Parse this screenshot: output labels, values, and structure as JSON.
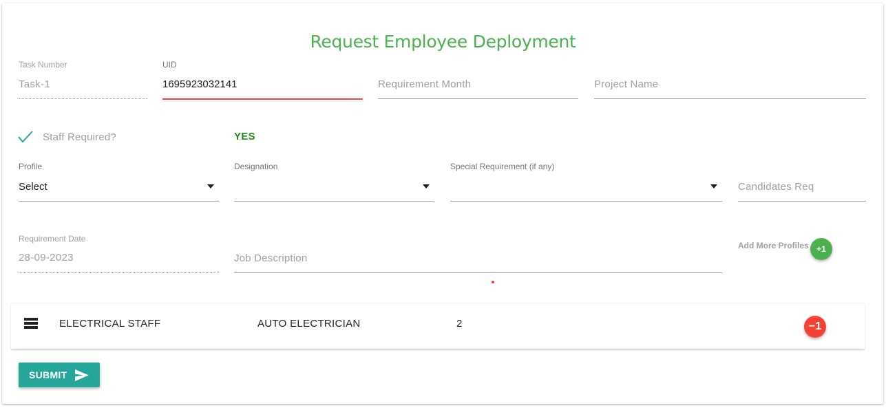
{
  "form": {
    "title": "Request Employee Deployment",
    "task_number": {
      "label": "Task Number",
      "value": "Task-1"
    },
    "uid": {
      "label": "UID",
      "value": "1695923032141"
    },
    "requirement_month": {
      "placeholder": "Requirement Month"
    },
    "project_name": {
      "placeholder": "Project Name"
    },
    "staff_required": {
      "label": "Staff Required?",
      "status": "YES"
    },
    "profile": {
      "label": "Profile",
      "value": "Select"
    },
    "designation": {
      "label": "Designation",
      "value": ""
    },
    "special_requirement": {
      "label": "Special Requirement (if any)",
      "value": ""
    },
    "candidates_req": {
      "placeholder": "Candidates Req"
    },
    "requirement_date": {
      "label": "Requirement Date",
      "value": "28-09-2023"
    },
    "job_description": {
      "placeholder": "Job Description"
    },
    "add_more": {
      "label": "Add More Profiles",
      "button": "+1"
    }
  },
  "profiles": [
    {
      "profile": "ELECTRICAL STAFF",
      "designation": "AUTO ELECTRICIAN",
      "count": "2",
      "remove_label": "−1"
    }
  ],
  "submit": {
    "label": "SUBMIT"
  },
  "icons": {
    "check": "check-icon",
    "list": "list-icon",
    "send": "send-icon",
    "caret": "caret-down-icon"
  },
  "colors": {
    "title": "#4caf50",
    "accent": "#26a69a",
    "error": "#f44336",
    "yes": "#1b8a1b"
  }
}
